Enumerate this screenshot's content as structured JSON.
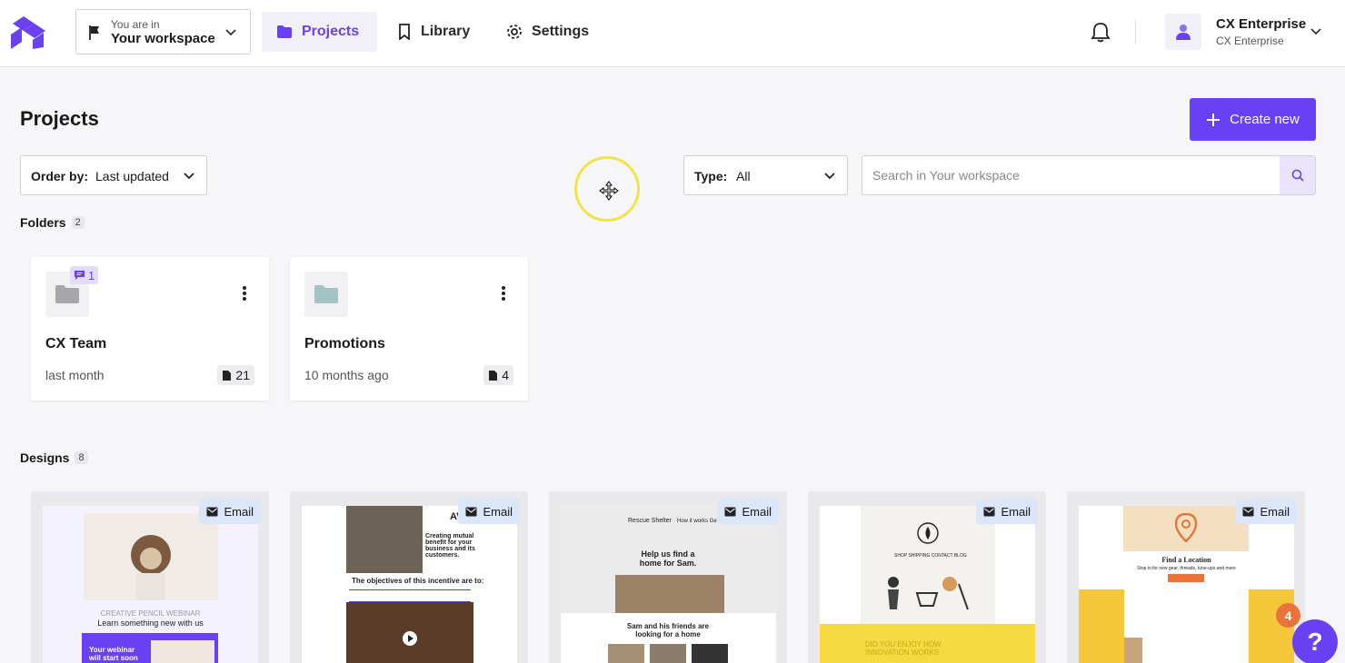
{
  "header": {
    "workspace_label": "You are in",
    "workspace_name": "Your workspace",
    "nav": [
      {
        "label": "Projects",
        "icon": "folder-icon",
        "active": true
      },
      {
        "label": "Library",
        "icon": "bookmark-icon",
        "active": false
      },
      {
        "label": "Settings",
        "icon": "gear-icon",
        "active": false
      }
    ],
    "account_name": "CX Enterprise",
    "account_sub": "CX Enterprise"
  },
  "page": {
    "title": "Projects",
    "create_label": "Create new",
    "order_label": "Order by:",
    "order_value": "Last updated",
    "type_label": "Type:",
    "type_value": "All",
    "search_placeholder": "Search in Your workspace"
  },
  "folders": {
    "title": "Folders",
    "count": "2",
    "items": [
      {
        "name": "CX Team",
        "time": "last month",
        "files": "21",
        "comments": "1",
        "color": "#a7a7ab"
      },
      {
        "name": "Promotions",
        "time": "10 months ago",
        "files": "4",
        "comments": "",
        "color": "#a3c4c3"
      }
    ]
  },
  "designs": {
    "title": "Designs",
    "count": "8",
    "type_tag": "Email",
    "thumbs": {
      "d1_caption": "CREATIVE PENCIL WEBINAR",
      "d1_heading": "Learn something new with us",
      "d1_banner": "Your webinar will start soon",
      "d2_brand": "AVC",
      "d2_tagline": "Creating mutual benefit for your business and its customers.",
      "d2_heading": "The objectives of this incentive are to:",
      "d3_brand": "Rescue Shelter",
      "d3_nav": "How it works   Get involved   Faq",
      "d3_heading": "Help us find a home for Sam.",
      "d3_sub": "Sam and his friends are looking for a home",
      "d4_nav": "SHOP   SHIPPING   CONTACT   BLOG",
      "d4_banner": "DID YOU ENJOY HOW INNOVATION WORKS",
      "d5_heading": "Find a Location",
      "d5_sub": "Stop in for new gear, threads, tune-ups and more"
    }
  },
  "widgets": {
    "notification_count": "4",
    "help_label": "?"
  }
}
